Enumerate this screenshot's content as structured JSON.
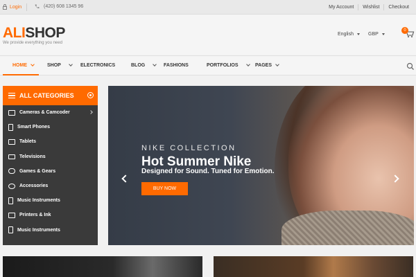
{
  "topbar": {
    "login": "Login",
    "phone": "(420) 608 1345 96",
    "links": [
      "My Account",
      "Wishlist",
      "Checkout"
    ]
  },
  "header": {
    "logo_part1": "ALI",
    "logo_part2": "SHOP",
    "tagline": "We provide everything you need",
    "language": "English",
    "currency": "GBP",
    "cart_count": "0"
  },
  "nav": {
    "items": [
      {
        "label": "HOME"
      },
      {
        "label": "SHOP"
      },
      {
        "label": "ELECTRONICS"
      },
      {
        "label": "BLOG"
      },
      {
        "label": "FASHIONS"
      },
      {
        "label": "PORTFOLIOS"
      },
      {
        "label": "PAGES"
      }
    ]
  },
  "categories": {
    "title": "ALL CATEGORIES",
    "items": [
      {
        "label": "Cameras & Camcoder"
      },
      {
        "label": "Smart Phones"
      },
      {
        "label": "Tablets"
      },
      {
        "label": "Televisions"
      },
      {
        "label": "Games & Gears"
      },
      {
        "label": "Accessories"
      },
      {
        "label": "Music Instruments"
      },
      {
        "label": "Printers & Ink"
      },
      {
        "label": "Music Instruments"
      }
    ]
  },
  "hero": {
    "kicker": "NIKE COLLECTION",
    "title": "Hot Summer Nike",
    "subtitle": "Designed for Sound. Tuned for Emotion.",
    "button": "BUY NOW"
  },
  "colors": {
    "accent": "#ff6a00",
    "sidebar_bg": "#3a3a3a"
  }
}
